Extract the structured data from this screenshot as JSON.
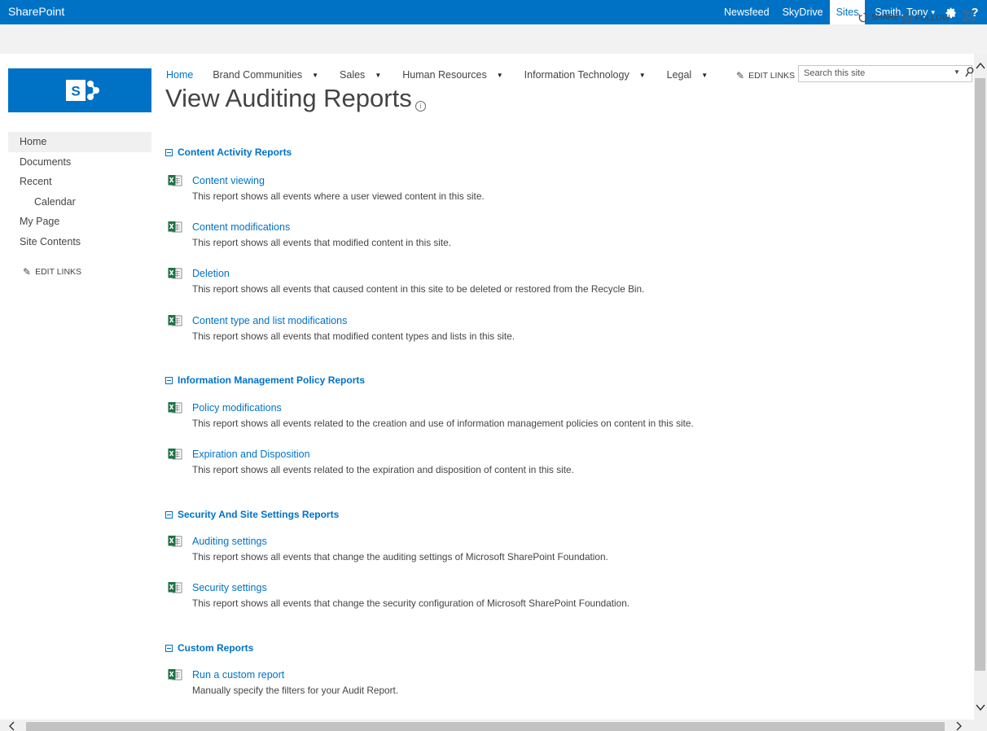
{
  "suite_bar": {
    "brand": "SharePoint",
    "links": [
      {
        "label": "Newsfeed",
        "active": false
      },
      {
        "label": "SkyDrive",
        "active": false
      },
      {
        "label": "Sites",
        "active": true
      }
    ],
    "user": "Smith, Tony",
    "settings_icon": "gear-icon",
    "help_icon": "question-mark",
    "help_label": "?"
  },
  "ribbon": {
    "share": "SHARE",
    "follow": "FOLLOW"
  },
  "top_nav": {
    "items": [
      {
        "label": "Home",
        "has_dropdown": false
      },
      {
        "label": "Brand Communities",
        "has_dropdown": true
      },
      {
        "label": "Sales",
        "has_dropdown": true
      },
      {
        "label": "Human Resources",
        "has_dropdown": true
      },
      {
        "label": "Information Technology",
        "has_dropdown": true
      },
      {
        "label": "Legal",
        "has_dropdown": true
      }
    ],
    "edit_links": "EDIT LINKS"
  },
  "search": {
    "placeholder": "Search this site"
  },
  "page": {
    "title": "View Auditing Reports",
    "info_glyph": "i"
  },
  "quick_launch": {
    "items": [
      {
        "label": "Home",
        "selected": true,
        "indent": false
      },
      {
        "label": "Documents",
        "selected": false,
        "indent": false
      },
      {
        "label": "Recent",
        "selected": false,
        "indent": false
      },
      {
        "label": "Calendar",
        "selected": false,
        "indent": true
      },
      {
        "label": "My Page",
        "selected": false,
        "indent": false
      },
      {
        "label": "Site Contents",
        "selected": false,
        "indent": false
      }
    ],
    "edit_links": "EDIT LINKS"
  },
  "sections": [
    {
      "title": "Content Activity Reports",
      "reports": [
        {
          "name": "Content viewing",
          "description": "This report shows all events where a user viewed content in this site."
        },
        {
          "name": "Content modifications",
          "description": "This report shows all events that modified content in this site."
        },
        {
          "name": "Deletion",
          "description": "This report shows all events that caused content in this site to be deleted or restored from the Recycle Bin."
        },
        {
          "name": "Content type and list modifications",
          "description": "This report shows all events that modified content types and lists in this site."
        }
      ]
    },
    {
      "title": "Information Management Policy Reports",
      "reports": [
        {
          "name": "Policy modifications",
          "description": "This report shows all events related to the creation and use of information management policies on content in this site."
        },
        {
          "name": "Expiration and Disposition",
          "description": "This report shows all events related to the expiration and disposition of content in this site."
        }
      ]
    },
    {
      "title": "Security And Site Settings Reports",
      "reports": [
        {
          "name": "Auditing settings",
          "description": "This report shows all events that change the auditing settings of Microsoft SharePoint Foundation."
        },
        {
          "name": "Security settings",
          "description": "This report shows all events that change the security configuration of Microsoft SharePoint Foundation."
        }
      ]
    },
    {
      "title": "Custom Reports",
      "reports": [
        {
          "name": "Run a custom report",
          "description": "Manually specify the filters for your Audit Report."
        }
      ]
    }
  ],
  "colors": {
    "suite_bar": "#0072c6",
    "link": "#0072c6",
    "text": "#444444",
    "excel_green": "#1e7145"
  }
}
